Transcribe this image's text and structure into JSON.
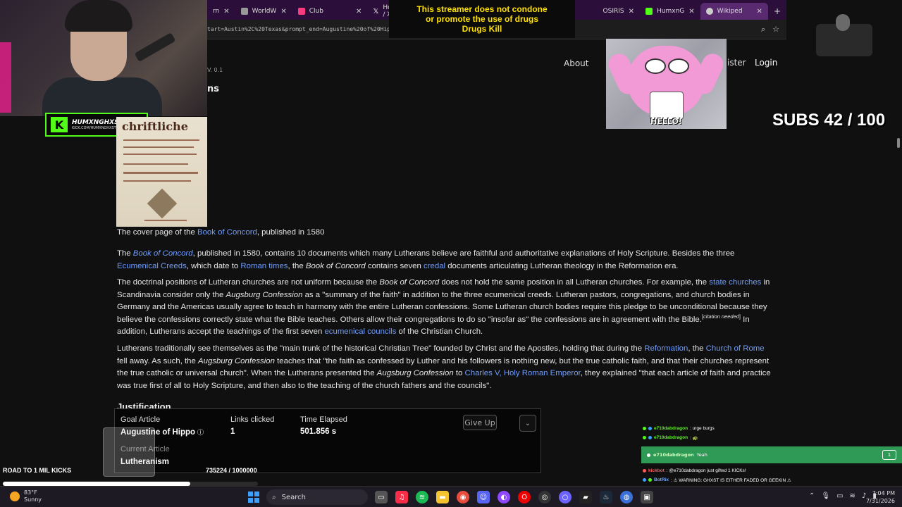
{
  "browser": {
    "tabs": [
      {
        "label": "rn",
        "icon": "page-icon",
        "active": false
      },
      {
        "label": "WorldW",
        "icon": "page-icon",
        "active": false
      },
      {
        "label": "Club",
        "icon": "club-icon",
        "active": false
      },
      {
        "label": "Home / X",
        "icon": "x-icon",
        "active": false
      },
      {
        "label": "OSIRIS",
        "icon": "page-icon",
        "active": false
      },
      {
        "label": "HumxnG",
        "icon": "kick-icon",
        "active": false
      },
      {
        "label": "Wikiped",
        "icon": "wiki-icon",
        "active": true
      }
    ],
    "address": "tart=Austin%2C%20Texas&prompt_end=Augustine%20of%20Hippo&lang=en"
  },
  "overlay": {
    "streamer_name": "HUMXNGHXST",
    "streamer_sub": "KICK.COM/HUMXNGHXST",
    "warning_lines": [
      "This streamer does not condone",
      "or promote the use of drugs",
      "Drugs Kill"
    ],
    "gif_caption": "HELLO!",
    "subs": "SUBS 42 / 100",
    "road_label": "ROAD TO 1 MIL KICKS",
    "road_count": "735224 / 1000000",
    "road_progress": 0.735
  },
  "site": {
    "nav_about": "About",
    "nav_register": "ister",
    "nav_login": "Login",
    "version": "V. 0.1",
    "heading_fragment": "ns"
  },
  "article": {
    "image_caption_pre": "The cover page of the ",
    "image_caption_link": "Book of Concord",
    "image_caption_post": ", published in 1580",
    "cover_text": "chriftliche",
    "section_heading": "Justification"
  },
  "game": {
    "goal_label": "Goal Article",
    "goal_value": "Augustine of Hippo",
    "links_label": "Links clicked",
    "links_value": "1",
    "time_label": "Time Elapsed",
    "time_value": "501.856 s",
    "current_label": "Current Article",
    "current_value": "Lutheranism",
    "give_up": "Give Up",
    "chevron": "⌄"
  },
  "chat": {
    "messages": [
      {
        "user": "e710dabdragon",
        "text": ": urge burgs",
        "color": "green"
      },
      {
        "user": "e710dabdragon",
        "text": ": 🐢",
        "color": "green"
      },
      {
        "user": "",
        "text": "",
        "color": "none"
      },
      {
        "user": "kickbot",
        "text": ": @e710dabdragon just gifted 1 KICKs!",
        "color": "red"
      },
      {
        "user": "BotRix",
        "text": ": ⚠ WARNING: GHXST IS EITHER FADED OR GEEKIN ⚠",
        "color": "blue"
      }
    ],
    "highlight_user": "e710dabdragon",
    "highlight_text": "Yeah",
    "highlight_badge": "1"
  },
  "taskbar": {
    "temp": "83°F",
    "weather": "Sunny",
    "search": "Search",
    "time": "7:04 PM",
    "date": "7/31/2026"
  },
  "colors": {
    "link": "#6f9dff",
    "kick_green": "#53fc18",
    "warning_yellow": "#ffe000",
    "tab_bar": "#2b0f3a"
  }
}
